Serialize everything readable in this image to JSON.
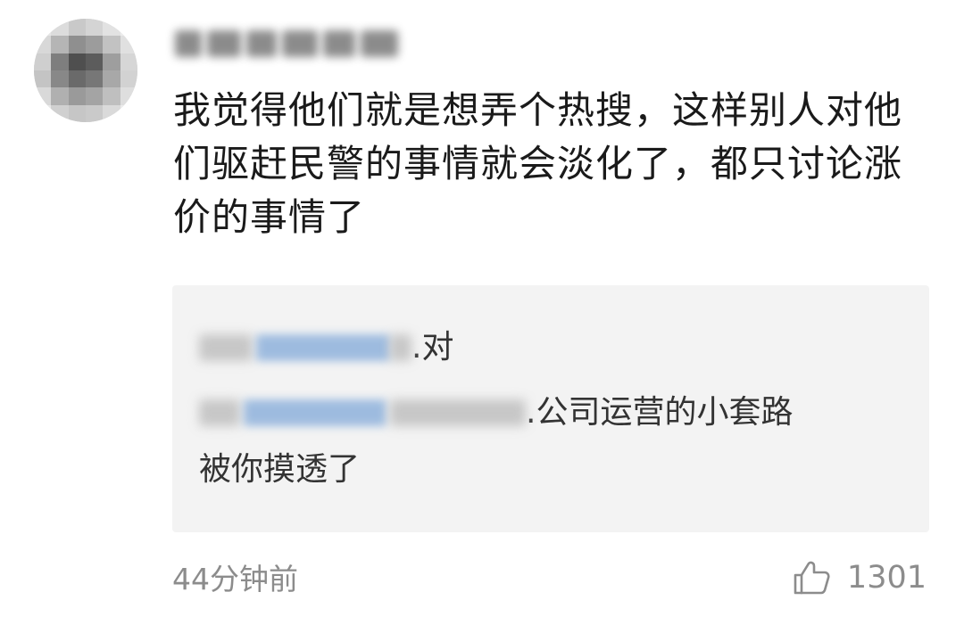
{
  "comment": {
    "author": {
      "name_obscured": "",
      "avatar_icon": "avatar-icon"
    },
    "text": "我觉得他们就是想弄个热搜，这样别人对他们驱赶民警的事情就会淡化了，都只讨论涨价的事情了",
    "reply": {
      "line1_suffix": ".对",
      "line2_suffix": ".公司运营的小套路",
      "line3": "被你摸透了"
    },
    "timestamp": "44分钟前",
    "likes": {
      "icon": "thumbs-up-icon",
      "count": "1301"
    }
  },
  "colors": {
    "text_primary": "#1a1a1a",
    "text_secondary": "#8c8c8c",
    "reply_background": "#f3f3f3",
    "link_blur": "#8fb2dc"
  }
}
